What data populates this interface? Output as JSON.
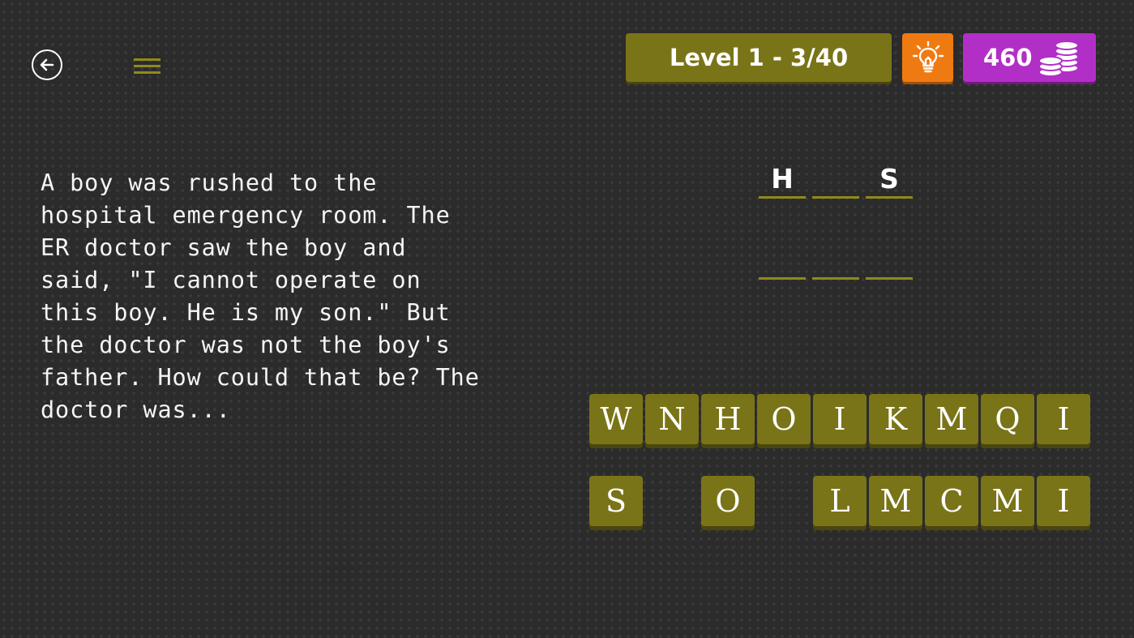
{
  "header": {
    "level_label": "Level 1 - 3/40",
    "coins": "460",
    "back_icon": "back-arrow-icon",
    "menu_icon": "hamburger-menu-icon",
    "hint_icon": "lightbulb-icon",
    "coin_icon": "coin-stack-icon"
  },
  "question": {
    "text": "A boy was rushed to the\nhospital emergency room. The\nER doctor saw the boy and\nsaid, \"I cannot operate on\nthis boy. He is my son.\" But\nthe doctor was not the boy's\nfather. How could that be? The\ndoctor was..."
  },
  "answer": {
    "words": [
      [
        "H",
        "",
        "S"
      ],
      [
        "",
        "",
        ""
      ]
    ]
  },
  "letters": {
    "row1": [
      "W",
      "N",
      "H",
      "O",
      "I",
      "K",
      "M",
      "Q",
      "I"
    ],
    "row2": [
      "S",
      "",
      "O",
      "",
      "L",
      "M",
      "C",
      "M",
      "I"
    ]
  },
  "colors": {
    "olive": "#7a7418",
    "olive_dark": "#4a470f",
    "hint_orange": "#f07a12",
    "coins_purple": "#b22fc7"
  }
}
